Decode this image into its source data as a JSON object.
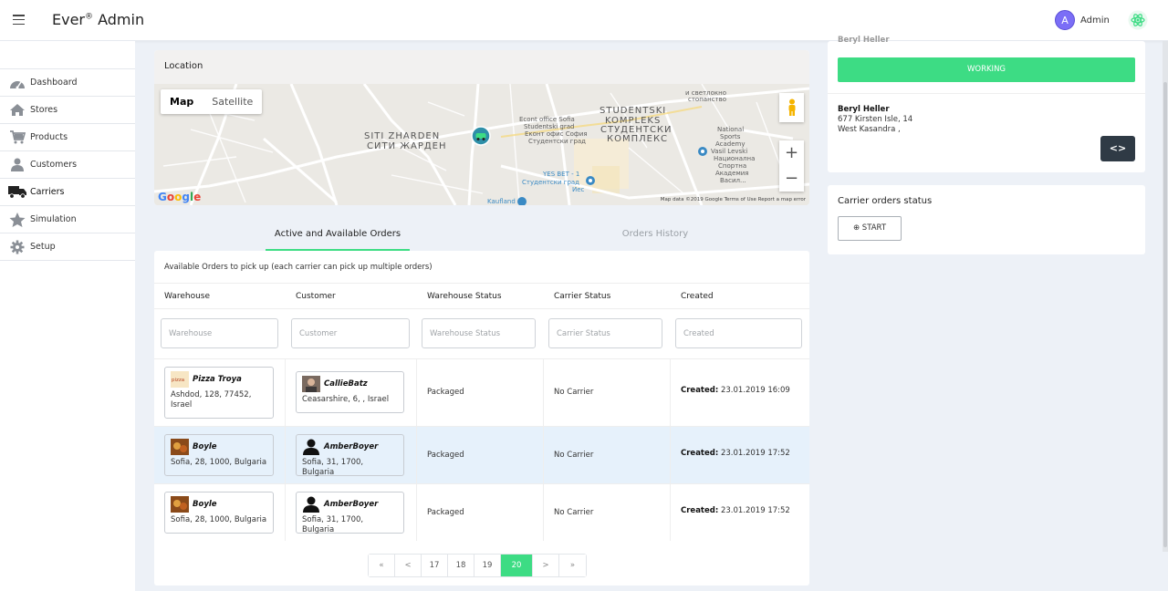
{
  "app": {
    "name": "Ever",
    "reg": "®",
    "suffix": " Admin"
  },
  "user": {
    "initial": "A",
    "name": "Admin"
  },
  "sidebar": {
    "items": [
      {
        "label": "Dashboard",
        "icon": "dashboard-icon"
      },
      {
        "label": "Stores",
        "icon": "home-icon"
      },
      {
        "label": "Products",
        "icon": "cart-icon"
      },
      {
        "label": "Customers",
        "icon": "person-icon"
      },
      {
        "label": "Carriers",
        "icon": "truck-icon",
        "active": true
      },
      {
        "label": "Simulation",
        "icon": "star-icon"
      },
      {
        "label": "Setup",
        "icon": "gear-icon"
      }
    ]
  },
  "location": {
    "title": "Location",
    "map_tabs": [
      "Map",
      "Satellite"
    ],
    "labels": {
      "siti": "SITI ZHARDEN",
      "siti_cyr": "СИТИ ЖАРДЕН",
      "studentski1": "STUDENTSKI",
      "studentski2": "KOMPLEKS",
      "studentski3": "СТУДЕНТСКИ",
      "studentski4": "КОМПЛЕКС",
      "econt1": "Econt office Sofia",
      "econt2": "Studentski grad",
      "econt3": "Еконт офис София",
      "econt4": "Студентски град",
      "nsa1": "National",
      "nsa2": "Sports",
      "nsa3": "Academy",
      "nsa4": "Vasil Levski",
      "nsa5": "Национална",
      "nsa6": "Спортна",
      "nsa7": "Академия",
      "nsa8": "Васил...",
      "yes1": "YES BET - 1",
      "yes2": "Студентски град",
      "yes3": "Иес",
      "kaufland": "Kaufland",
      "top1": "и светлокно",
      "top2": "стопанство"
    },
    "google": "Google",
    "footer": "Map data ©2019 Google   Terms of Use   Report a map error"
  },
  "tabs": {
    "active": "Active and Available Orders",
    "history": "Orders History"
  },
  "orders": {
    "note": "Available Orders to pick up (each carrier can pick up multiple orders)",
    "columns": [
      "Warehouse",
      "Customer",
      "Warehouse Status",
      "Carrier Status",
      "Created"
    ],
    "placeholders": [
      "Warehouse",
      "Customer",
      "Warehouse Status",
      "Carrier Status",
      "Created"
    ],
    "rows": [
      {
        "wh_name": "Pizza Troya",
        "wh_addr1": "Ashdod, 128, 77452,",
        "wh_addr2": "Israel",
        "cust_name": "CallieBatz",
        "cust_addr": "Ceasarshire, 6, , Israel",
        "wh_status": "Packaged",
        "carrier_status": "No Carrier",
        "created_label": "Created:",
        "created": " 23.01.2019 16:09"
      },
      {
        "wh_name": "Boyle",
        "wh_addr1": "Sofia, 28, 1000, Bulgaria",
        "wh_addr2": "",
        "cust_name": "AmberBoyer",
        "cust_addr": "Sofia, 31, 1700, Bulgaria",
        "wh_status": "Packaged",
        "carrier_status": "No Carrier",
        "created_label": "Created:",
        "created": " 23.01.2019 17:52"
      },
      {
        "wh_name": "Boyle",
        "wh_addr1": "Sofia, 28, 1000, Bulgaria",
        "wh_addr2": "",
        "cust_name": "AmberBoyer",
        "cust_addr": "Sofia, 31, 1700, Bulgaria",
        "wh_status": "Packaged",
        "carrier_status": "No Carrier",
        "created_label": "Created:",
        "created": " 23.01.2019 17:52"
      }
    ],
    "pager": [
      "«",
      "<",
      "17",
      "18",
      "19",
      "20",
      ">",
      "»"
    ],
    "current_page": "20"
  },
  "carrier": {
    "top_name": "Beryl Heller",
    "status_button": "WORKING",
    "customer_name": "Beryl Heller",
    "customer_addr1": "677 Kirsten Isle, 14",
    "customer_addr2": "West Kasandra ,",
    "code_button": "<>"
  },
  "carrier_orders": {
    "title": "Carrier orders status",
    "start": "⊕ START"
  },
  "colors": {
    "accent": "#3ddc84",
    "selected_row": "#e6f1fb",
    "dark_button": "#2f3a45",
    "avatar": "#7b6ef6"
  }
}
